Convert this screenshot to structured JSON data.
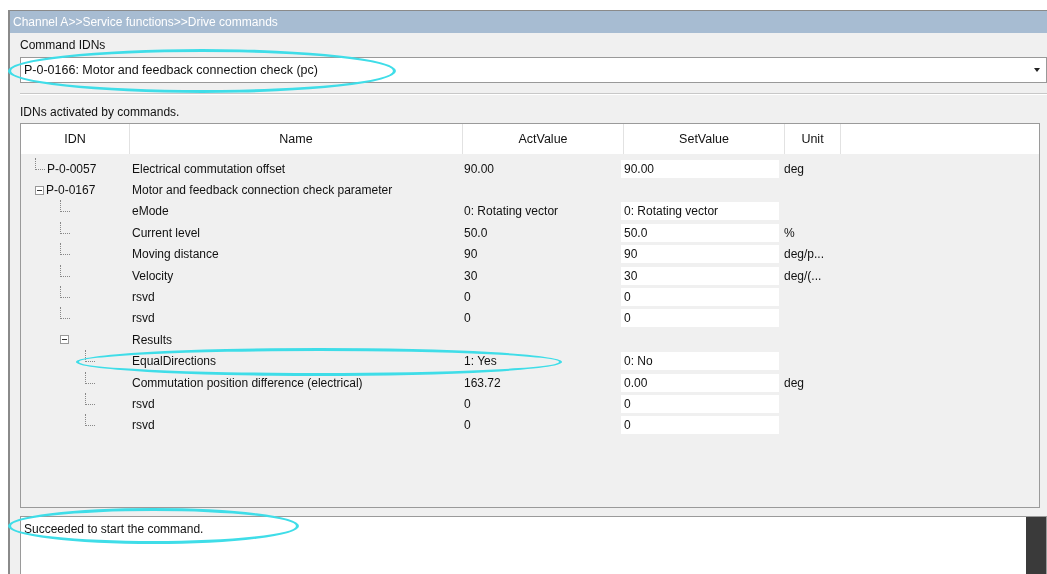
{
  "window": {
    "title": "Channel A>>Service functions>>Drive commands"
  },
  "command": {
    "label": "Command IDNs",
    "value": "P-0-0166: Motor and feedback connection check (pc)",
    "highlight": true
  },
  "table": {
    "caption": "IDNs activated by commands.",
    "columns": [
      "IDN",
      "Name",
      "ActValue",
      "SetValue",
      "Unit"
    ],
    "rows": [
      {
        "idn": "P-0-0057",
        "name": "Electrical commutation offset",
        "act": "90.00",
        "set": "90.00",
        "unit": "deg",
        "highlight": false
      },
      {
        "idn": "P-0-0167",
        "name": "Motor and feedback connection check parameter",
        "expanded": true,
        "highlight": false,
        "children": [
          {
            "name": "eMode",
            "act": "0: Rotating vector",
            "set": "0: Rotating vector",
            "highlight": false
          },
          {
            "name": "Current level",
            "act": "50.0",
            "set": "50.0",
            "unit": "%",
            "highlight": false
          },
          {
            "name": "Moving distance",
            "act": "90",
            "set": "90",
            "unit": "deg/p...",
            "highlight": false
          },
          {
            "name": "Velocity",
            "act": "30",
            "set": "30",
            "unit": "deg/(...",
            "highlight": false
          },
          {
            "name": "rsvd",
            "act": "0",
            "set": "0",
            "highlight": false
          },
          {
            "name": "rsvd",
            "act": "0",
            "set": "0",
            "highlight": false
          },
          {
            "name": "Results",
            "expanded": true,
            "highlight": false,
            "children": [
              {
                "name": "EqualDirections",
                "act": "1: Yes",
                "set": "0: No",
                "highlight": true
              },
              {
                "name": "Commutation position difference (electrical)",
                "act": "163.72",
                "set": "0.00",
                "unit": "deg",
                "highlight": false
              },
              {
                "name": "rsvd",
                "act": "0",
                "set": "0",
                "highlight": false
              },
              {
                "name": "rsvd",
                "act": "0",
                "set": "0",
                "highlight": false
              }
            ]
          }
        ]
      }
    ]
  },
  "message": {
    "text": "Succeeded to start the command.",
    "highlight": true
  }
}
